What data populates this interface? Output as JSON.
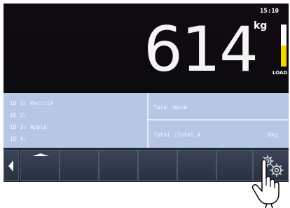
{
  "status": {
    "time": "15:10",
    "unit": "kg",
    "load_label": "LOAD",
    "load_level": 0.5
  },
  "weight": {
    "value": "614"
  },
  "ids": [
    {
      "label": "ID 1: Patrick"
    },
    {
      "label": "ID 2: -"
    },
    {
      "label": "ID 3: Apple"
    },
    {
      "label": "ID 4: -"
    }
  ],
  "tare": {
    "text": "Tare  :None"
  },
  "total": {
    "text": "Total :Total A",
    "value": "0kg"
  },
  "icons": {
    "left": "chevron-left-icon",
    "up": "arrow-up-icon",
    "settings": "gear-icon",
    "hand": "pointing-hand-icon"
  },
  "colors": {
    "display_bg": "#0f0b10",
    "info_bg": "#b6c6e4",
    "softkey_bg": "#2a3240",
    "load_bar": "#f0d800"
  }
}
